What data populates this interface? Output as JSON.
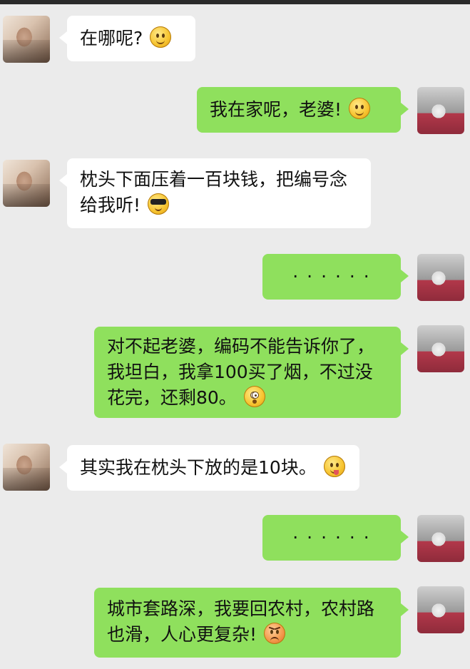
{
  "chat": {
    "messages": [
      {
        "side": "left",
        "text": "在哪呢?",
        "emoji": "smile-emoji"
      },
      {
        "side": "right",
        "text": "我在家呢，老婆!",
        "emoji": "smile-emoji"
      },
      {
        "side": "left",
        "line1": "枕头下面压着一百块钱，把编号念",
        "line2": "给我听!",
        "emoji": "sunglasses-emoji"
      },
      {
        "side": "right",
        "text": "· · · · · ·"
      },
      {
        "side": "right",
        "line1": "对不起老婆，编码不能告诉你了，",
        "line2": "我坦白，我拿100买了烟，不过没",
        "line3": "花完，还剩80。",
        "emoji": "shocked-emoji"
      },
      {
        "side": "left",
        "text": "其实我在枕头下放的是10块。",
        "emoji": "tongue-emoji"
      },
      {
        "side": "right",
        "text": "· · · · · ·"
      },
      {
        "side": "right",
        "line1": "城市套路深，我要回农村，农村路",
        "line2": "也滑，人心更复杂!",
        "emoji": "angry-emoji"
      }
    ]
  },
  "colors": {
    "background": "#ebebeb",
    "bubble_left": "#ffffff",
    "bubble_right": "#8fe05d",
    "top_bar": "#2a2a2a"
  }
}
